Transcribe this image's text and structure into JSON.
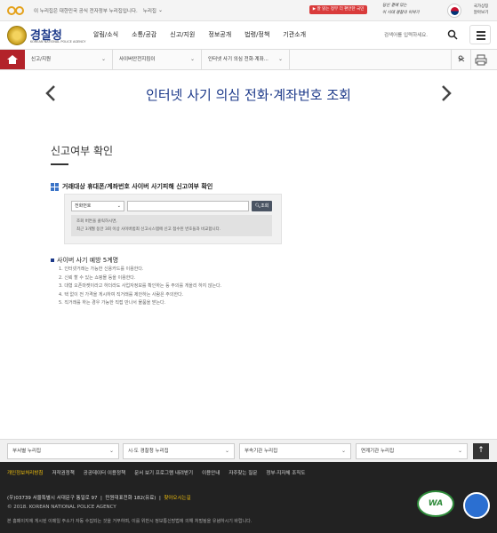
{
  "gov_banner": {
    "notice": "이 누리집은 대한민국 공식 전자정부 누리집입니다.",
    "link": "누리집",
    "promo1": "▶ 잘 읽는 정부 더 편안한 국민",
    "promo2_line1": "당신 곁에 있는",
    "promo2_line2": "이 시대 경찰의 이야기",
    "flag_text_line1": "국가상징",
    "flag_text_line2": "알아보기"
  },
  "header": {
    "logo_ko": "경찰청",
    "logo_en": "KOREAN NATIONAL POLICE AGENCY",
    "nav": [
      "알림/소식",
      "소통/공감",
      "신고/지원",
      "정보공개",
      "법령/정책",
      "기관소개"
    ],
    "search_placeholder": "검색어를 입력하세요."
  },
  "breadcrumb": {
    "items": [
      "신고/지원",
      "사이버안전지킴이",
      "인터넷 사기 의심 전화·계좌..."
    ]
  },
  "page": {
    "title": "인터넷 사기 의심 전화·계좌번호 조회",
    "section_title": "신고여부 확인",
    "sub_heading": "거래대상 휴대폰/계좌번호 사이버 사기피해 신고여부 확인",
    "select_value": "전화번호",
    "query_button": "조회",
    "notice_line1": "조회 버튼을 클릭하시면,",
    "notice_line2": "최근 3개월 동안 3회 이상 사이버범죄 신고시스템에 신고 접수된 번호들과 비교합니다.",
    "tips_heading": "사이버 사기 예방 5계명",
    "tips": [
      "1. 인터넷거래는 가능한 신용카드를 이용한다.",
      "2. 신뢰 할 수 있는 쇼핑몰 등을 이용한다.",
      "3. 대형 오픈마켓이라고 하더라도 사업자정보를 확인하는 등 주의를 게을리 하지 않는다.",
      "4. 택 없이 전 가격을 게시하여 직거래를 제안하는 사람은 주의한다.",
      "5. 직거래를 하는 경우 가능한 직접 만나서 물품을 받는다."
    ]
  },
  "footer": {
    "selects": [
      "부서별 누리집",
      "시·도 경찰청 누리집",
      "부속기관 누리집",
      "연계기관 누리집"
    ],
    "top_button": "↑",
    "links": [
      "개인정보처리방침",
      "저작권정책",
      "공공데이터 이용정책",
      "문서 보기 프로그램 내려받기",
      "이용안내",
      "자주찾는 질문",
      "정부·지자체 조직도"
    ],
    "address": "(우)03739 서울특별시 서대문구 통일로 97",
    "phone": "민원대표전화 182(유료)",
    "directions": "찾아오시는길",
    "copyright": "© 2018. KOREAN NATIONAL POLICE AGENCY",
    "policy": "본 홈페이지에 게시된 이메일 주소가 자동 수집되는 것을 거부하며, 이를 위반시 정보통신망법에 의해 처벌됨을 유념하시기 바랍니다.",
    "wa_badge": "WA"
  }
}
